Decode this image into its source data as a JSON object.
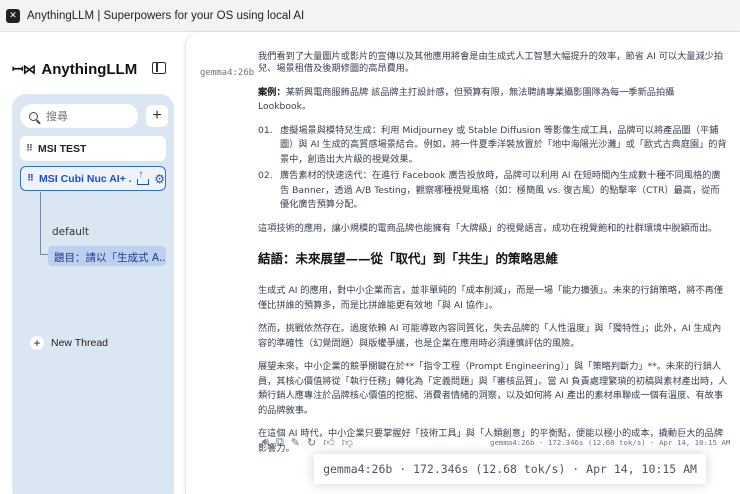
{
  "window": {
    "title": "AnythingLLM | Superpowers for your OS using local AI"
  },
  "sidebar": {
    "brand": "AnythingLLM",
    "search_placeholder": "搜尋",
    "workspaces": [
      {
        "label": "MSI TEST",
        "active": false
      },
      {
        "label": "MSI Cubi Nuc AI+ ...",
        "active": true
      }
    ],
    "threads": [
      {
        "label": "default",
        "selected": false
      },
      {
        "label": "題目：請以「生成式 A...",
        "selected": true
      }
    ],
    "new_thread_label": "New Thread"
  },
  "chat": {
    "model_tag": "gemma4:26b",
    "partial_top": "我們看到了大量圖片或影片的宣傳以及其他應用將會是由生成式人工智慧大幅提升的效率，節省 AI 可以大量減少拍攝場景搭建與",
    "partial_line2": "兒、場景租借及後期修圖的高昂費用。",
    "case_label": "案例：",
    "case_text": "某新興電商服飾品牌 該品牌主打設計感，但預算有限，無法聘請專業攝影團隊為每一季新品拍攝 Lookbook。",
    "list_items": [
      {
        "num": "01.",
        "text": "虛擬場景與模特兒生成：利用 Midjourney 或 Stable Diffusion 等影像生成工具，品牌可以將產品圖（平鋪圖）與 AI 生成的高質感場景結合。例如，將一件夏季洋裝放置於「地中海陽光沙灘」或「歐式古典庭園」的背景中，創造出大片級的視覺效果。"
      },
      {
        "num": "02.",
        "text": "廣告素材的快速迭代：在進行 Facebook 廣告投放時，品牌可以利用 AI 在短時間內生成數十種不同風格的廣告 Banner，透過 A/B Testing，觀察哪種視覺風格（如：極簡風 vs. 復古風）的點擊率（CTR）最高，從而優化廣告預算分配。"
      }
    ],
    "para_after_list": "這項技術的應用，讓小規模的電商品牌也能擁有「大牌級」的視覺語言，成功在視覺飽和的社群環境中脫穎而出。",
    "heading": "結語：未來展望——從「取代」到「共生」的策略思維",
    "paragraphs": [
      "生成式 AI 的應用，對中小企業而言，並非單純的「成本削減」，而是一場「能力擴張」。未來的行銷策略，將不再僅僅比拼誰的預算多，而是比拼誰能更有效地「與 AI 協作」。",
      "然而，挑戰依然存在。過度依賴 AI 可能導致內容同質化，失去品牌的「人性溫度」與「獨特性」；此外，AI 生成內容的準確性（幻覺問題）與版權爭議，也是企業在應用時必須謹慎評估的風險。",
      "展望未來，中小企業的競爭關鍵在於**「指令工程（Prompt Engineering）」與「策略判斷力」**。未來的行銷人員，其核心價值將從「執行任務」轉化為「定義問題」與「審核品質」。當 AI 負責處理繁瑣的初稿與素材產出時，人類行銷人應專注於品牌核心價值的挖掘、消費者情緒的洞察，以及如何將 AI 產出的素材串聯成一個有溫度、有故事的品牌敘事。",
      "在這個 AI 時代，中小企業只要掌握好「技術工具」與「人類創意」的平衡點，便能以極小的成本，撬動巨大的品牌影響力。"
    ],
    "meta": "gemma4:26b · 172.346s (12.68 tok/s) · Apr 14, 10:15 AM"
  },
  "tooltip": {
    "text": "gemma4:26b · 172.346s (12.68 tok/s) · Apr 14, 10:15 AM"
  }
}
